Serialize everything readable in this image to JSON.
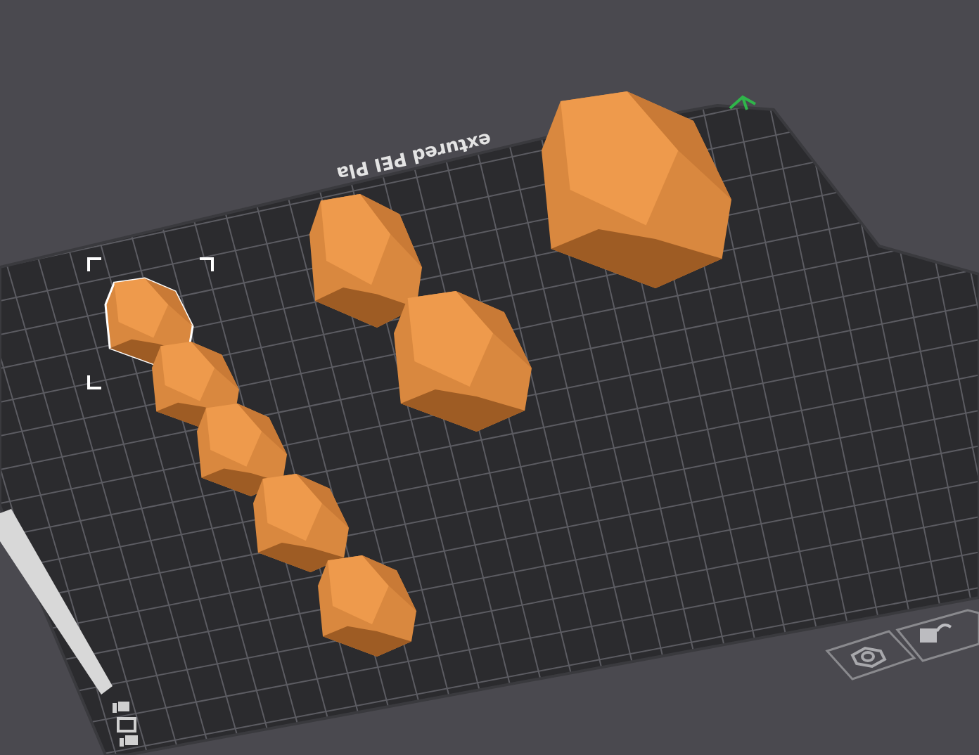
{
  "bed": {
    "label": "extured PEI Pla"
  },
  "objects": [
    {
      "selected": true
    },
    {
      "selected": false
    },
    {
      "selected": false
    },
    {
      "selected": false
    },
    {
      "selected": false
    },
    {
      "selected": false
    },
    {
      "selected": false
    },
    {
      "selected": false
    }
  ]
}
